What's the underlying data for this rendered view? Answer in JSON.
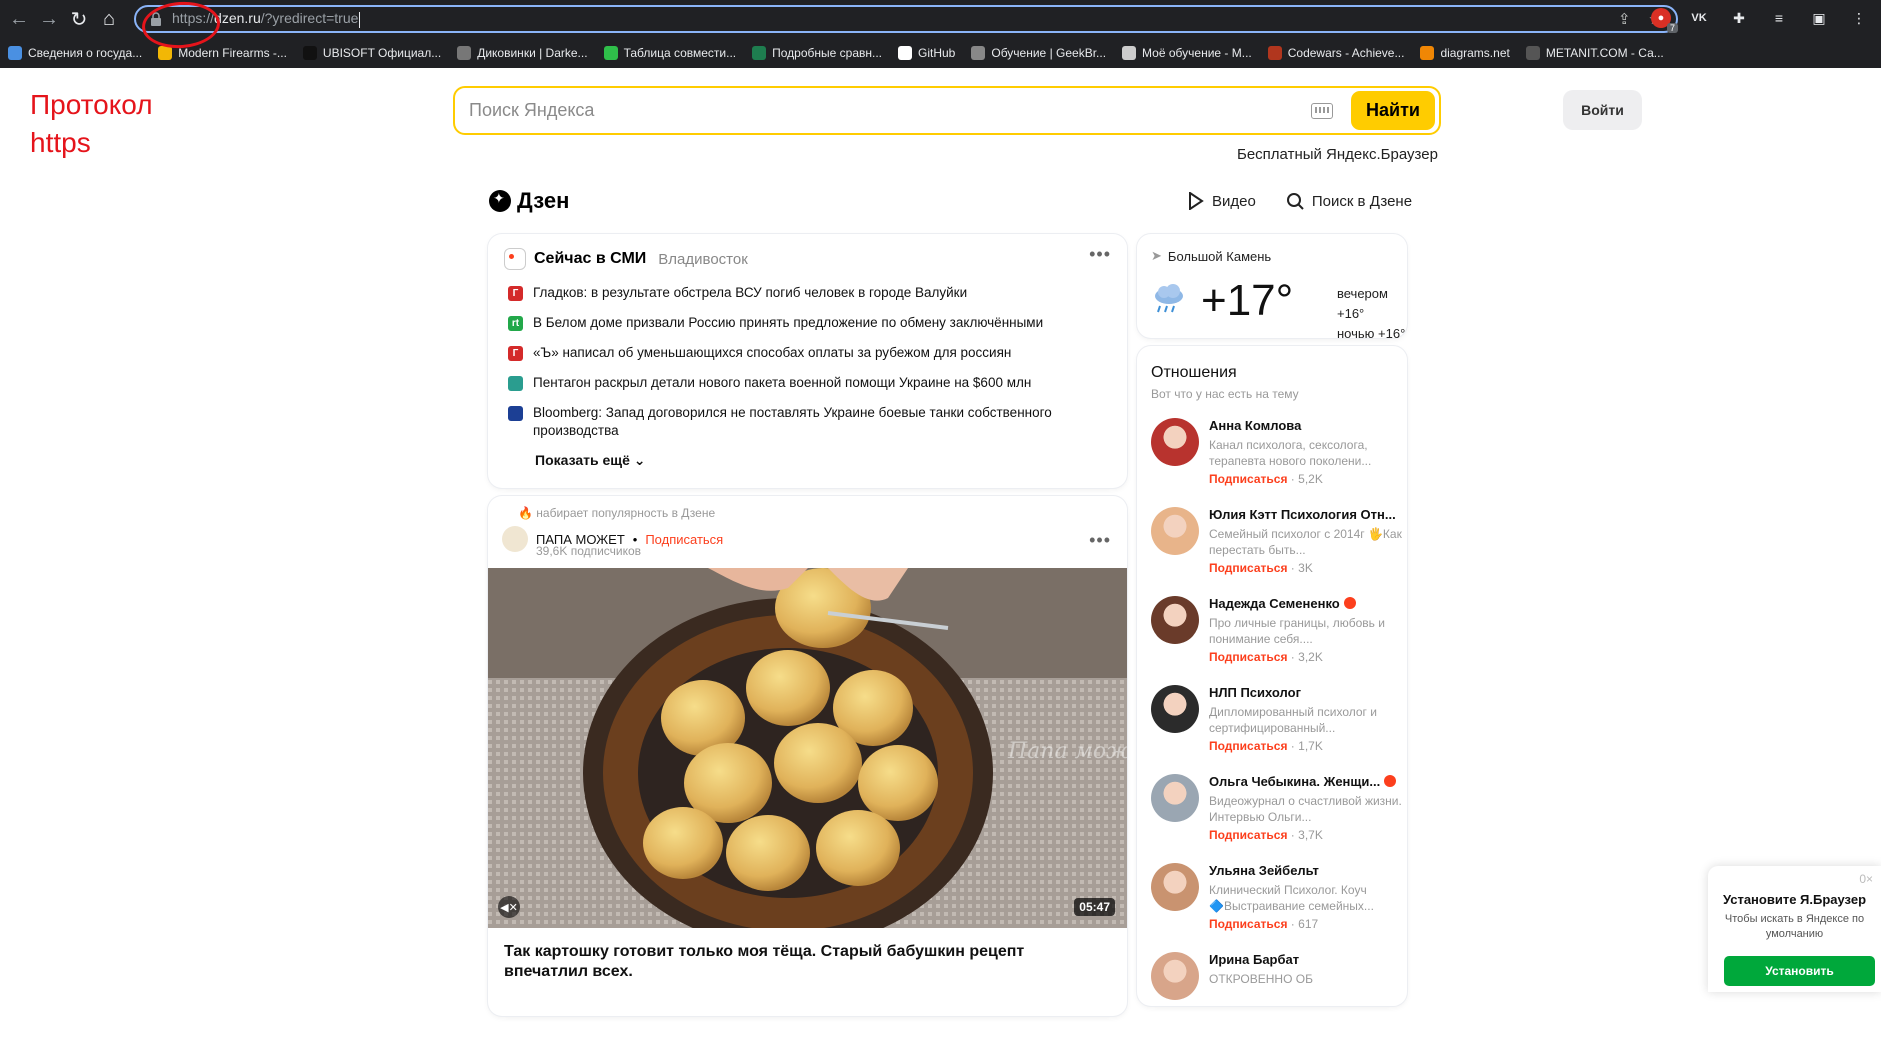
{
  "browser": {
    "url_protocol": "https://",
    "url_host": "dzen.ru",
    "url_path": "/?yredirect=true",
    "bookmarks": [
      {
        "label": "Сведения о госуда...",
        "color": "#4a90e2"
      },
      {
        "label": "Modern Firearms -...",
        "color": "#f2b705"
      },
      {
        "label": "UBISOFT Официал...",
        "color": "#111111"
      },
      {
        "label": "Диковинки | Darke...",
        "color": "#777777"
      },
      {
        "label": "Таблица совмести...",
        "color": "#2fbf4a"
      },
      {
        "label": "Подробные сравн...",
        "color": "#1e7d4f"
      },
      {
        "label": "GitHub",
        "color": "#ffffff"
      },
      {
        "label": "Обучение | GeekBr...",
        "color": "#888888"
      },
      {
        "label": "Моё обучение - M...",
        "color": "#cccccc"
      },
      {
        "label": "Codewars - Achieve...",
        "color": "#b1361e"
      },
      {
        "label": "diagrams.net",
        "color": "#f08705"
      },
      {
        "label": "METANIT.COM - Са...",
        "color": "#555555"
      }
    ]
  },
  "annotation": {
    "line1": "Протокол",
    "line2": "https",
    "color": "#e5141b"
  },
  "search": {
    "placeholder": "Поиск Яндекса",
    "button_label": "Найти",
    "accent": "#ffcc00"
  },
  "header": {
    "login_label": "Войти",
    "browser_promo": "Бесплатный Яндекс.Браузер",
    "logo_text": "Дзен",
    "video_label": "Видео",
    "search_dzen_label": "Поиск в Дзене"
  },
  "news": {
    "title": "Сейчас в СМИ",
    "city": "Владивосток",
    "show_more": "Показать ещё",
    "items": [
      {
        "text": "Гладков: в результате обстрела ВСУ погиб человек в городе Валуйки",
        "source_color": "#d42a2a",
        "source_mark": "Г"
      },
      {
        "text": "В Белом доме призвали Россию принять предложение по обмену заключёнными",
        "source_color": "#22a84a",
        "source_mark": "rt"
      },
      {
        "text": "«Ъ» написал об уменьшающихся способах оплаты за рубежом для россиян",
        "source_color": "#d42a2a",
        "source_mark": "Г"
      },
      {
        "text": "Пентагон раскрыл детали нового пакета военной помощи Украине на $600 млн",
        "source_color": "#2a9d8f",
        "source_mark": ""
      },
      {
        "text": "Bloomberg: Запад договорился не поставлять Украине боевые танки собственного производства",
        "source_color": "#1c3f94",
        "source_mark": ""
      }
    ]
  },
  "weather": {
    "location": "Большой Камень",
    "temperature": "+17°",
    "evening": "вечером +16°",
    "night": "ночью +16°"
  },
  "relations": {
    "title": "Отношения",
    "subtitle": "Вот что у нас есть на тему",
    "follow_label": "Подписаться",
    "items": [
      {
        "name": "Анна Комлова",
        "desc": "Канал психолога, сексолога, терапевта нового поколени...",
        "count": "5,2K",
        "verified": false,
        "avatar_color": "#b8332e"
      },
      {
        "name": "Юлия Кэтт Психология Отн...",
        "desc": "Семейный психолог с 2014г 🖐Как перестать быть...",
        "count": "3K",
        "verified": false,
        "avatar_color": "#e8b48a"
      },
      {
        "name": "Надежда Семененко",
        "desc": "Про личные границы, любовь и понимание себя....",
        "count": "3,2K",
        "verified": true,
        "avatar_color": "#6a3b2a"
      },
      {
        "name": "НЛП Психолог",
        "desc": "Дипломированный психолог и сертифицированный...",
        "count": "1,7K",
        "verified": false,
        "avatar_color": "#2b2b2b"
      },
      {
        "name": "Ольга Чебыкина. Женщи...",
        "desc": "Видеожурнал о счастливой жизни. Интервью Ольги...",
        "count": "3,7K",
        "verified": true,
        "avatar_color": "#9aa6b2"
      },
      {
        "name": "Ульяна Зейбельт",
        "desc": "Клинический Психолог. Коуч 🔷Выстраивание семейных...",
        "count": "617",
        "verified": false,
        "avatar_color": "#c99370"
      },
      {
        "name": "Ирина Барбат",
        "desc": "ОТКРОВЕННО ОБ",
        "count": "",
        "verified": false,
        "avatar_color": "#d8a58a"
      }
    ]
  },
  "post": {
    "trending": "набирает популярность в Дзене",
    "channel": "ПАПА МОЖЕТ",
    "follow": "Подписаться",
    "subscribers": "39,6K подписчиков",
    "duration": "05:47",
    "title": "Так картошку готовит только моя тёща. Старый бабушкин рецепт впечатлил всех.",
    "watermark": "Папа может"
  },
  "popup": {
    "title": "Установите Я.Браузер",
    "text": "Чтобы искать в Яндексе по умолчанию",
    "button": "Установить",
    "close": "0×"
  }
}
